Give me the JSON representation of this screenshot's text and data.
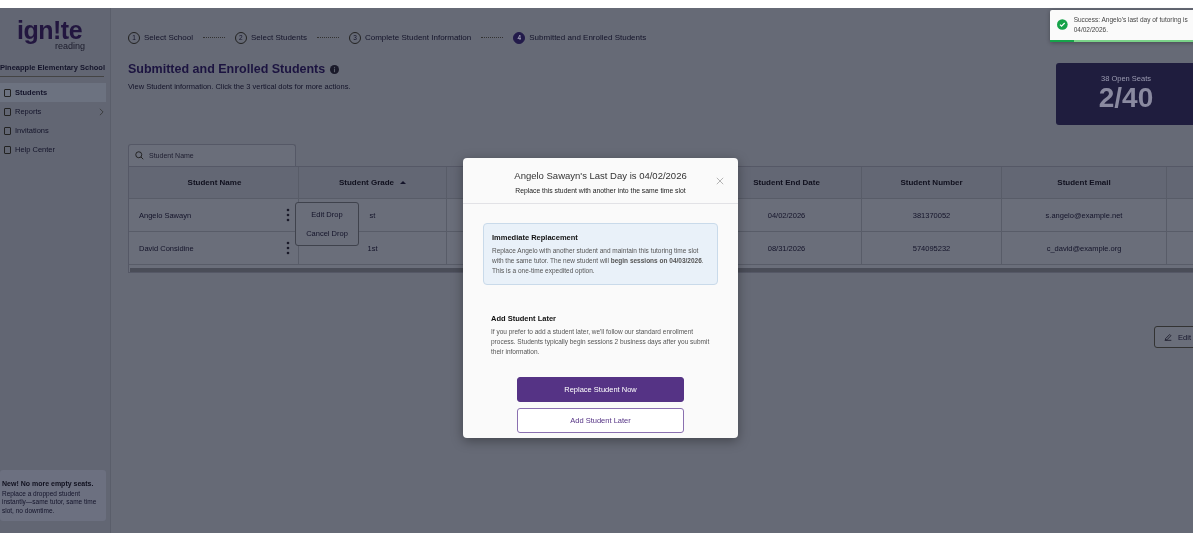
{
  "sidebar": {
    "logo": "ign!te",
    "logo_sub": "reading",
    "school": "Pineapple Elementary School",
    "items": [
      {
        "label": "Students",
        "selected": true,
        "has_submenu": false
      },
      {
        "label": "Reports",
        "selected": false,
        "has_submenu": true
      },
      {
        "label": "Invitations",
        "selected": false,
        "has_submenu": false
      },
      {
        "label": "Help Center",
        "selected": false,
        "has_submenu": false
      }
    ],
    "promo": {
      "title": "New! No more empty seats.",
      "text": "Replace a dropped student instantly—same tutor, same time slot, no downtime."
    }
  },
  "stepper": [
    {
      "number": "1",
      "label": "Select School",
      "selected": false
    },
    {
      "number": "2",
      "label": "Select Students",
      "selected": false
    },
    {
      "number": "3",
      "label": "Complete Student Information",
      "selected": false
    },
    {
      "number": "4",
      "label": "Submitted and Enrolled Students",
      "selected": true
    }
  ],
  "page": {
    "title": "Submitted and Enrolled Students",
    "subtitle": "View Student information. Click the 3 vertical dots for more actions."
  },
  "seats": {
    "caption": "38 Open Seats",
    "value": "2/40"
  },
  "search": {
    "placeholder": "Student Name"
  },
  "table": {
    "columns": [
      {
        "label": "Student Name",
        "sorted": false
      },
      {
        "label": "Student Grade",
        "sorted": true
      },
      {
        "label": "Student End Date",
        "sorted": false
      },
      {
        "label": "Student Number",
        "sorted": false
      },
      {
        "label": "Student Email",
        "sorted": false
      }
    ],
    "rows": [
      {
        "cells": [
          "Angelo Sawayn",
          "st",
          "04/02/2026",
          "381370052",
          "s.angelo@example.net"
        ]
      },
      {
        "cells": [
          "David Considine",
          "1st",
          "08/31/2026",
          "574095232",
          "c_david@example.org"
        ]
      }
    ]
  },
  "row_menu": {
    "items": [
      "Edit Drop",
      "Cancel Drop"
    ]
  },
  "edit_button": {
    "label": "Edit"
  },
  "toast": {
    "message": "Success: Angelo's last day of tutoring is 04/02/2026.",
    "level": 0.16
  },
  "modal": {
    "title": "Angelo Sawayn's Last Day is 04/02/2026",
    "subtitle": "Replace this student with another into the same time slot",
    "options": [
      {
        "title": "Immediate Replacement",
        "text": "Replace Angelo with another student and maintain this tutoring time slot with the same tutor. The new student will **begin sessions on 04/03/2026**. This is a one-time expedited option.",
        "selected": true
      },
      {
        "title": "Add Student Later",
        "text": "If you prefer to add a student later, we'll follow our standard enrollment process. Students typically begin sessions 2 business days after you submit their information.",
        "selected": false
      }
    ],
    "buttons": [
      {
        "label": "Replace Student Now",
        "kind": "primary"
      },
      {
        "label": "Add Student Later",
        "kind": "secondary"
      }
    ]
  }
}
